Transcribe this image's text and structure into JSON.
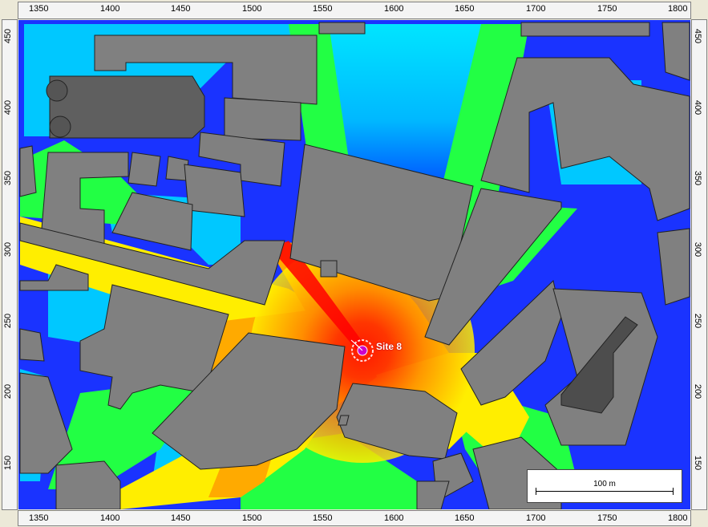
{
  "x_ticks": [
    "1350",
    "1400",
    "1450",
    "1500",
    "1550",
    "1600",
    "1650",
    "1700",
    "1750",
    "1800"
  ],
  "y_ticks": [
    "450",
    "400",
    "350",
    "300",
    "250",
    "200",
    "150"
  ],
  "site": {
    "label": "Site 8"
  },
  "scale": {
    "label": "100 m"
  },
  "colors": {
    "strong": "#ff0000",
    "high": "#ffaa00",
    "medium": "#ffff00",
    "mid": "#00ff44",
    "low": "#00e5ff",
    "weak": "#1a33ff",
    "building": "#808080",
    "building_dark": "#555555"
  }
}
